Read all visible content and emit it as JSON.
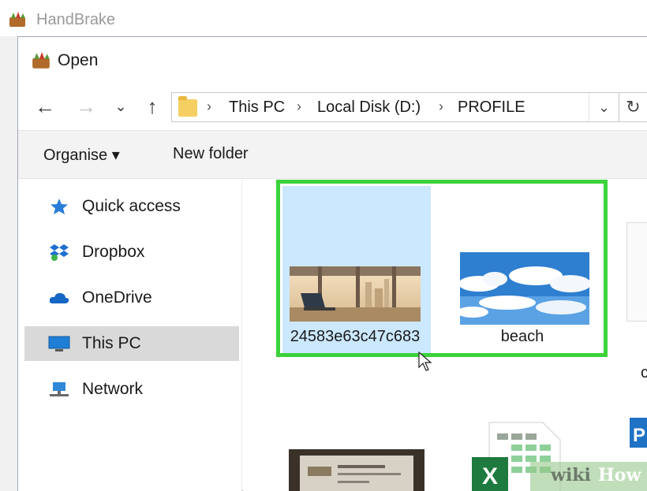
{
  "app": {
    "title": "HandBrake"
  },
  "dialog": {
    "title": "Open"
  },
  "navigation": {
    "back_glyph": "←",
    "forward_glyph": "→",
    "recent_glyph": "⌄",
    "up_glyph": "↑",
    "breadcrumbs": [
      "This PC",
      "Local Disk (D:)",
      "PROFILE"
    ],
    "separator": "›",
    "dropdown_glyph": "⌄",
    "refresh_glyph": "↻"
  },
  "toolbar": {
    "organise_label": "Organise ▾",
    "new_folder_label": "New folder"
  },
  "sidebar": {
    "items": [
      {
        "label": "Quick access",
        "icon": "star-icon",
        "selected": false
      },
      {
        "label": "Dropbox",
        "icon": "dropbox-icon",
        "selected": false
      },
      {
        "label": "OneDrive",
        "icon": "cloud-icon",
        "selected": false
      },
      {
        "label": "This PC",
        "icon": "computer-icon",
        "selected": true
      },
      {
        "label": "Network",
        "icon": "network-icon",
        "selected": false
      }
    ]
  },
  "files": [
    {
      "name": "24583e63c47c683",
      "icon": "city-office-thumbnail",
      "selected": true
    },
    {
      "name": "beach",
      "icon": "sky-clouds-thumbnail",
      "selected": false
    },
    {
      "name": "co",
      "icon": "document-thumbnail",
      "selected": false
    }
  ],
  "watermark": {
    "part1": "wiki",
    "part2": "How"
  },
  "colors": {
    "highlight": "#3bd23b",
    "selection": "#cce8ff",
    "sidebar_selected": "#d9d9d9"
  }
}
